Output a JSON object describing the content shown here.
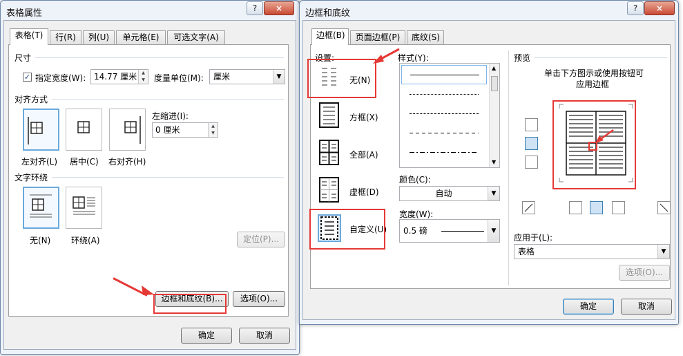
{
  "table_props": {
    "title": "表格属性",
    "help_label": "?",
    "close_label": "×",
    "tabs": [
      "表格(T)",
      "行(R)",
      "列(U)",
      "单元格(E)",
      "可选文字(A)"
    ],
    "size": {
      "header": "尺寸",
      "pref_width_checked": true,
      "pref_width_label": "指定宽度(W):",
      "width_value": "14.77 厘米",
      "unit_label": "度量单位(M):",
      "unit_value": "厘米"
    },
    "alignment": {
      "header": "对齐方式",
      "options": [
        "左对齐(L)",
        "居中(C)",
        "右对齐(H)"
      ],
      "selected": "左对齐(L)",
      "indent_label": "左缩进(I):",
      "indent_value": "0 厘米"
    },
    "wrapping": {
      "header": "文字环绕",
      "options": [
        "无(N)",
        "环绕(A)"
      ],
      "selected": "无(N)",
      "position_button": "定位(P)..."
    },
    "borders_button": "边框和底纹(B)...",
    "options_button": "选项(O)...",
    "ok": "确定",
    "cancel": "取消"
  },
  "borders": {
    "title": "边框和底纹",
    "help_label": "?",
    "close_label": "×",
    "tabs": [
      "边框(B)",
      "页面边框(P)",
      "底纹(S)"
    ],
    "setting_header": "设置:",
    "settings": [
      "无(N)",
      "方框(X)",
      "全部(A)",
      "虚框(D)",
      "自定义(U)"
    ],
    "selected_setting": "自定义(U)",
    "style_header": "样式(Y):",
    "styles": [
      "solid",
      "dotted",
      "dashed-fine",
      "dashed",
      "dash-dot"
    ],
    "selected_style": "solid",
    "color_label": "颜色(C):",
    "color_value": "自动",
    "width_label": "宽度(W):",
    "width_value": "0.5 磅",
    "preview_header": "预览",
    "preview_hint_line1": "单击下方图示或使用按钮可",
    "preview_hint_line2": "应用边框",
    "apply_label": "应用于(L):",
    "apply_value": "表格",
    "options_button": "选项(O)...",
    "ok": "确定",
    "cancel": "取消"
  },
  "colors": {
    "highlight": "#e53935",
    "selection": "#6aa9dc",
    "window_frame": "#eef3fa"
  }
}
